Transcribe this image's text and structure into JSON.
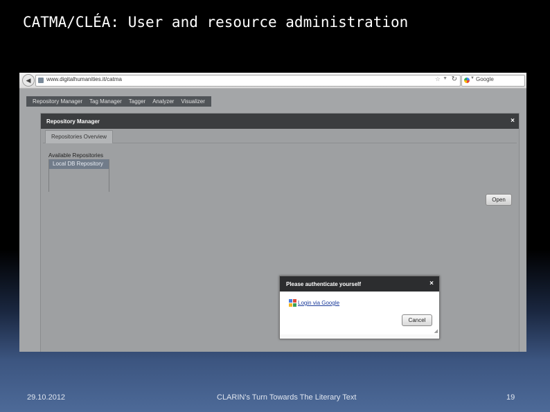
{
  "slide": {
    "title": "CATMA/CLÉA: User and resource administration",
    "footer_date": "29.10.2012",
    "footer_center": "CLARIN's Turn Towards The Literary Text",
    "page_number": "19"
  },
  "browser": {
    "url": "www.digitalhumanities.it/catma",
    "search_engine": "Google"
  },
  "app": {
    "menu": [
      "Repository Manager",
      "Tag Manager",
      "Tagger",
      "Analyzer",
      "Visualizer"
    ],
    "repo_window": {
      "title": "Repository Manager",
      "close": "×",
      "tab": "Repositories Overview",
      "available_label": "Available Repositories",
      "repositories": [
        "Local DB Repository"
      ],
      "open_button": "Open"
    },
    "auth_dialog": {
      "title": "Please authenticate yourself",
      "close": "×",
      "login_link": "Login via Google",
      "cancel_button": "Cancel"
    }
  },
  "colors": {
    "window_header": "#3b3d3f",
    "selected_repo": "#717c8a",
    "link": "#1a3a9a"
  },
  "icons": [
    "back-arrow-icon",
    "site-icon",
    "star-icon",
    "reload-icon",
    "google-icon",
    "close-icon",
    "resize-grip-icon"
  ]
}
